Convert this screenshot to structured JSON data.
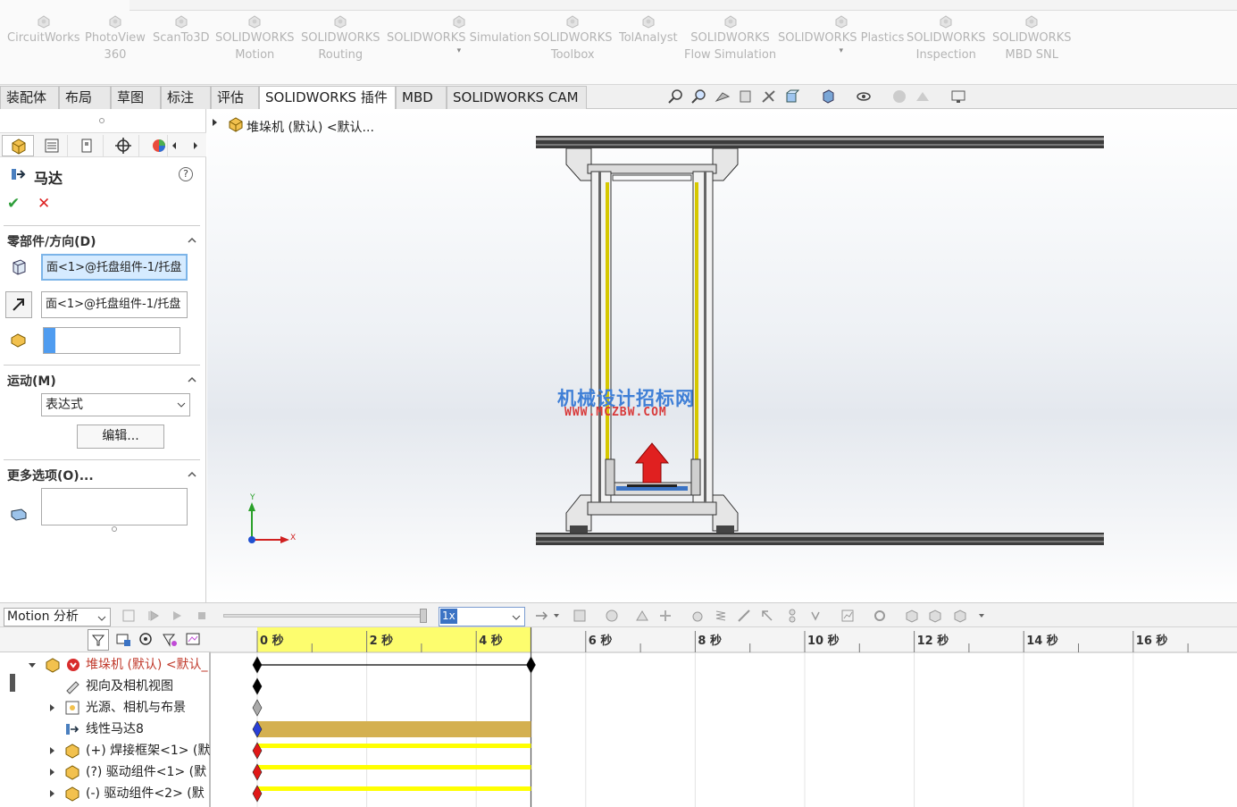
{
  "ribbon": {
    "items": [
      {
        "label": "CircuitWorks",
        "sub": "",
        "icon": "circuitworks-icon",
        "dropdown": false
      },
      {
        "label": "PhotoView",
        "sub": "360",
        "icon": "photoview-icon",
        "dropdown": false
      },
      {
        "label": "ScanTo3D",
        "sub": "",
        "icon": "scanto3d-icon",
        "dropdown": false
      },
      {
        "label": "SOLIDWORKS",
        "sub": "Motion",
        "icon": "motion-icon",
        "dropdown": false
      },
      {
        "label": "SOLIDWORKS",
        "sub": "Routing",
        "icon": "routing-icon",
        "dropdown": false
      },
      {
        "label": "SOLIDWORKS Simulation",
        "sub": "",
        "icon": "simulation-icon",
        "dropdown": true
      },
      {
        "label": "SOLIDWORKS",
        "sub": "Toolbox",
        "icon": "toolbox-icon",
        "dropdown": false
      },
      {
        "label": "TolAnalyst",
        "sub": "",
        "icon": "tolanalyst-icon",
        "dropdown": false
      },
      {
        "label": "SOLIDWORKS",
        "sub": "Flow Simulation",
        "icon": "flow-simulation-icon",
        "dropdown": false
      },
      {
        "label": "SOLIDWORKS Plastics",
        "sub": "",
        "icon": "plastics-icon",
        "dropdown": true
      },
      {
        "label": "SOLIDWORKS",
        "sub": "Inspection",
        "icon": "inspection-icon",
        "dropdown": false
      },
      {
        "label": "SOLIDWORKS",
        "sub": "MBD SNL",
        "icon": "mbd-snl-icon",
        "dropdown": false
      }
    ]
  },
  "tabs": [
    "装配体",
    "布局",
    "草图",
    "标注",
    "评估",
    "SOLIDWORKS 插件",
    "MBD",
    "SOLIDWORKS CAM"
  ],
  "active_tab": "SOLIDWORKS 插件",
  "graphics": {
    "tree_flyout": "堆垛机 (默认) <默认...",
    "watermark_line1": "机械设计招标网",
    "watermark_line2": "WWW.MCZBW.COM",
    "axis_y": "Y",
    "axis_x": "X"
  },
  "property_manager": {
    "title": "马达",
    "help": "?",
    "ok": "✔",
    "cancel": "✕",
    "sections": {
      "component_direction": "零部件/方向(D)",
      "motion": "运动(M)",
      "more_options": "更多选项(O)..."
    },
    "face_field_1": "面<1>@托盘组件-1/托盘",
    "face_field_2": "面<1>@托盘组件-1/托盘",
    "motion_type": "表达式",
    "edit_button": "编辑..."
  },
  "motion": {
    "study_type": "Motion 分析",
    "speed": "1x",
    "time_labels": [
      "0 秒",
      "2 秒",
      "4 秒",
      "6 秒",
      "8 秒",
      "10 秒",
      "12 秒",
      "14 秒",
      "16 秒"
    ],
    "tree": [
      {
        "label": "堆垛机 (默认) <默认_",
        "indent": 0,
        "expanded": true,
        "color": "#c0392b",
        "icon": "assembly-icon"
      },
      {
        "label": "视向及相机视图",
        "indent": 1,
        "expanded": null,
        "color": "#222",
        "icon": "camera-view-icon"
      },
      {
        "label": "光源、相机与布景",
        "indent": 1,
        "expanded": false,
        "color": "#222",
        "icon": "lights-icon"
      },
      {
        "label": "线性马达8",
        "indent": 1,
        "expanded": null,
        "color": "#222",
        "icon": "linear-motor-icon"
      },
      {
        "label": "(+) 焊接框架<1> (默",
        "indent": 1,
        "expanded": false,
        "color": "#222",
        "icon": "part-icon"
      },
      {
        "label": "(?) 驱动组件<1> (默",
        "indent": 1,
        "expanded": false,
        "color": "#222",
        "icon": "subassembly-icon"
      },
      {
        "label": "(-) 驱动组件<2> (默",
        "indent": 1,
        "expanded": false,
        "color": "#222",
        "icon": "subassembly-icon"
      }
    ]
  }
}
